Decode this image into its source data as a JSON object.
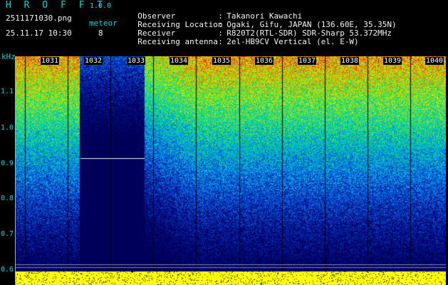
{
  "header": {
    "app_title": "H R O F F T",
    "version": "1.0.0",
    "file_name": "2511171030.png",
    "timestamp": "25.11.17 10:30",
    "meteor_label": "meteor",
    "meteor_count": "8"
  },
  "metadata": [
    {
      "label": "Observer",
      "value": "Takanori Kawachi"
    },
    {
      "label": "Receiving Location",
      "value": "Ogaki, Gifu, JAPAN (136.60E, 35.35N)"
    },
    {
      "label": "Receiver",
      "value": "R820T2(RTL-SDR) SDR-Sharp 53.372MHz"
    },
    {
      "label": "Receiving antenna",
      "value": "2el-HB9CV Vertical (el. E-W)"
    }
  ],
  "axis": {
    "unit": "kHz",
    "y_ticks": [
      "1.1",
      "1.0",
      "0.9",
      "0.8",
      "0.7",
      "0.6"
    ],
    "x_ticks": [
      "1031",
      "1032",
      "1033",
      "1034",
      "1035",
      "1036",
      "1037",
      "1038",
      "1039",
      "1040"
    ]
  },
  "colors": {
    "accent": "#00d8e0",
    "signal_band": "#ffff00",
    "background": "#000000"
  }
}
